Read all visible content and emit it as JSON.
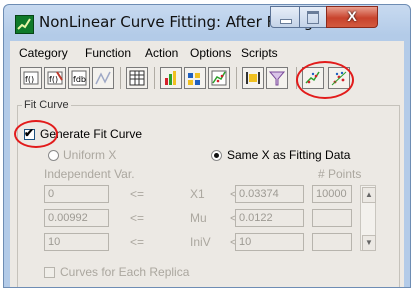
{
  "window": {
    "title": "NonLinear Curve Fitting: After Fitting",
    "close_glyph": "X"
  },
  "menu": [
    "Category",
    "Function",
    "Action",
    "Options",
    "Scripts"
  ],
  "toolbar": {
    "icons": [
      "fdb-category-icon",
      "edit-function-icon",
      "function-organizer-icon",
      "simulate-curve-icon",
      "worksheet-icon",
      "parameter-plot-icon",
      "parameters-table-icon",
      "fitting-graph-icon",
      "fit-range-icon",
      "funnel-fit-icon",
      "fit-one-iteration-icon",
      "fit-until-converge-icon"
    ],
    "highlight_color": "#e21b1b"
  },
  "fit_curve": {
    "group_label": "Fit Curve",
    "generate_label": "Generate Fit Curve",
    "generate_checked": true,
    "uniform_x_label": "Uniform X",
    "same_x_label": "Same X as Fitting Data",
    "x_mode_selected": "same_x",
    "independent_var_label": "Independent Var.",
    "points_label": "# Points",
    "rows": [
      {
        "from": "0",
        "op1": "<=",
        "var": "X1",
        "op2": "<=",
        "to": "0.03374",
        "points": "10000"
      },
      {
        "from": "0.00992",
        "op1": "<=",
        "var": "Mu",
        "op2": "<=",
        "to": "0.0122",
        "points": ""
      },
      {
        "from": "10",
        "op1": "<=",
        "var": "IniV",
        "op2": "<=",
        "to": "10",
        "points": ""
      }
    ],
    "replica_label": "Curves for Each Replica",
    "replica_checked": false
  },
  "colors": {
    "titlebar": "#b3cbe8",
    "client": "#ece9e4",
    "disabled_text": "#aba79f",
    "annotation": "#e21b1b"
  }
}
